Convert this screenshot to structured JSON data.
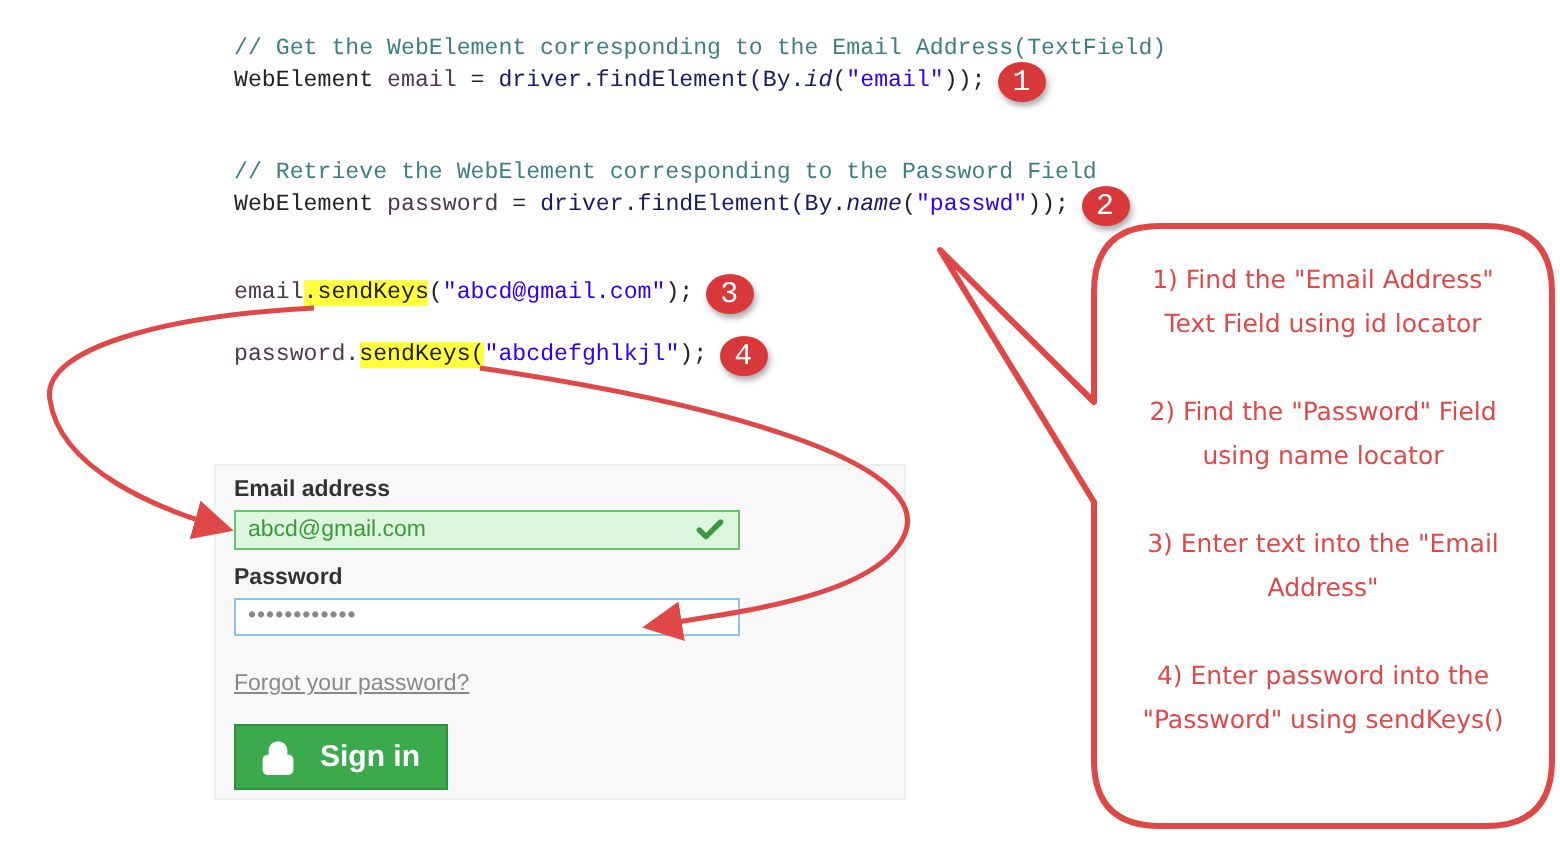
{
  "code_blocks": [
    {
      "badge": "1",
      "lines": [
        [
          {
            "kind": "comment",
            "text": "// Get the WebElement corresponding to the Email Address(TextField)"
          }
        ],
        [
          {
            "kind": "plain",
            "text": "WebElement "
          },
          {
            "kind": "variable",
            "text": "email"
          },
          {
            "kind": "plain",
            "text": " = "
          },
          {
            "kind": "field",
            "text": "driver.findElement(By."
          },
          {
            "kind": "italic",
            "text": "id"
          },
          {
            "kind": "plain",
            "text": "("
          },
          {
            "kind": "string",
            "text": "\"email\""
          },
          {
            "kind": "plain",
            "text": "));"
          }
        ]
      ]
    },
    {
      "badge": "2",
      "lines": [
        [
          {
            "kind": "comment",
            "text": "// Retrieve the WebElement corresponding to the Password Field"
          }
        ],
        [
          {
            "kind": "plain",
            "text": "WebElement "
          },
          {
            "kind": "variable",
            "text": "password"
          },
          {
            "kind": "plain",
            "text": " = "
          },
          {
            "kind": "field",
            "text": "driver.findElement(By."
          },
          {
            "kind": "italic",
            "text": "name"
          },
          {
            "kind": "plain",
            "text": "("
          },
          {
            "kind": "string",
            "text": "\"passwd\""
          },
          {
            "kind": "plain",
            "text": "));"
          }
        ]
      ]
    },
    {
      "badge": "3",
      "lines": [
        [
          {
            "kind": "variable",
            "text": "email"
          },
          {
            "kind": "highlight",
            "text": ".sendKeys"
          },
          {
            "kind": "plain",
            "text": "("
          },
          {
            "kind": "string",
            "text": "\"abcd@gmail.com\""
          },
          {
            "kind": "plain",
            "text": ");"
          }
        ]
      ]
    },
    {
      "badge": "4",
      "lines": [
        [
          {
            "kind": "variable",
            "text": "password."
          },
          {
            "kind": "highlight",
            "text": "sendKeys("
          },
          {
            "kind": "string",
            "text": "\"abcdefghlkjl\""
          },
          {
            "kind": "plain",
            "text": ");"
          }
        ]
      ]
    }
  ],
  "login_form": {
    "email_label": "Email address",
    "email_value": "abcd@gmail.com",
    "email_valid": true,
    "password_label": "Password",
    "password_value": "••••••••••••",
    "forgot_link": "Forgot your password?",
    "sign_in_button": "Sign in"
  },
  "callout": {
    "steps": [
      "1) Find the \"Email Address\" Text Field using id locator",
      "2) Find the \"Password\" Field using name locator",
      "3) Enter text into the \"Email Address\"",
      "4) Enter password into the \"Password\" using sendKeys()"
    ]
  }
}
